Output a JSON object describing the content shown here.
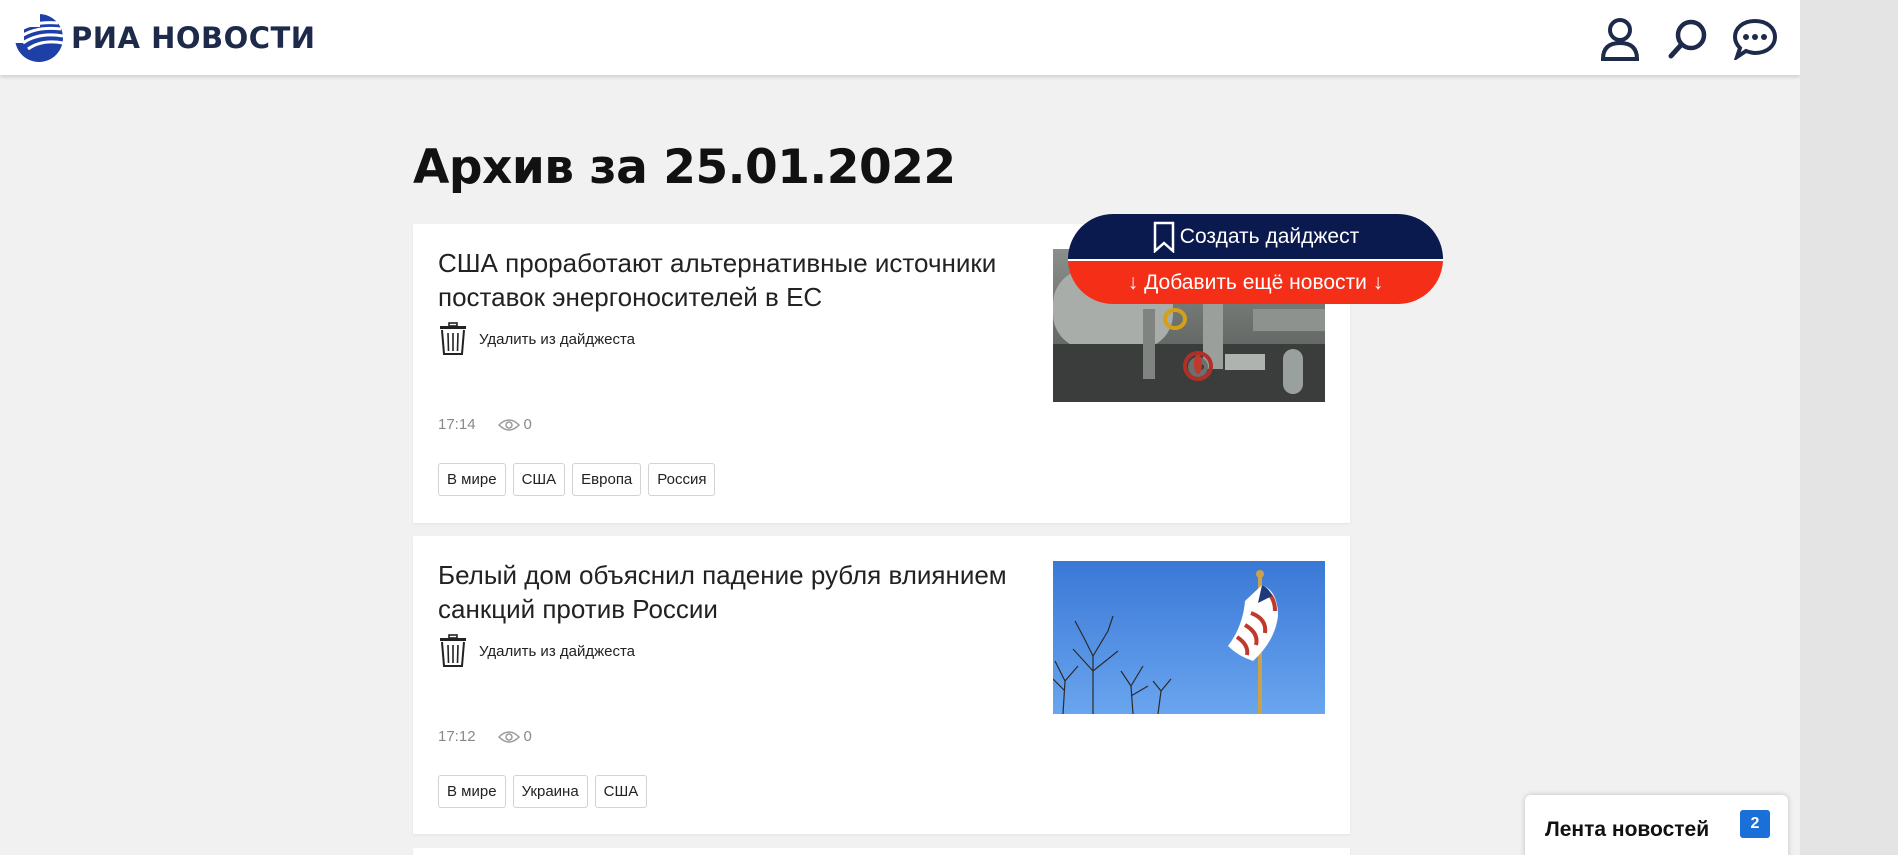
{
  "header": {
    "logo_text": "РИА НОВОСТИ",
    "icons": [
      "user-icon",
      "search-icon",
      "chat-icon"
    ],
    "brand_color": "#1e2a4a"
  },
  "archive": {
    "title": "Архив за 25.01.2022"
  },
  "digest": {
    "create_label": "Создать дайджест",
    "add_more_label": "↓ Добавить ещё новости ↓",
    "create_color": "#0b1a4e",
    "add_color": "#f42e17"
  },
  "articles": [
    {
      "title": "США проработают альтернативные источники поставок энергоносителей в ЕС",
      "remove_label": "Удалить из дайджеста",
      "time": "17:14",
      "views": "0",
      "tags": [
        "В мире",
        "США",
        "Европа",
        "Россия"
      ],
      "image": "gas-pipeline-valves"
    },
    {
      "title": "Белый дом объяснил падение рубля влиянием санкций против России",
      "remove_label": "Удалить из дайджеста",
      "time": "17:12",
      "views": "0",
      "tags": [
        "В мире",
        "Украина",
        "США"
      ],
      "image": "us-flag-on-pole"
    }
  ],
  "news_feed": {
    "label": "Лента новостей",
    "count": "2",
    "badge_color": "#1b6fd8"
  }
}
